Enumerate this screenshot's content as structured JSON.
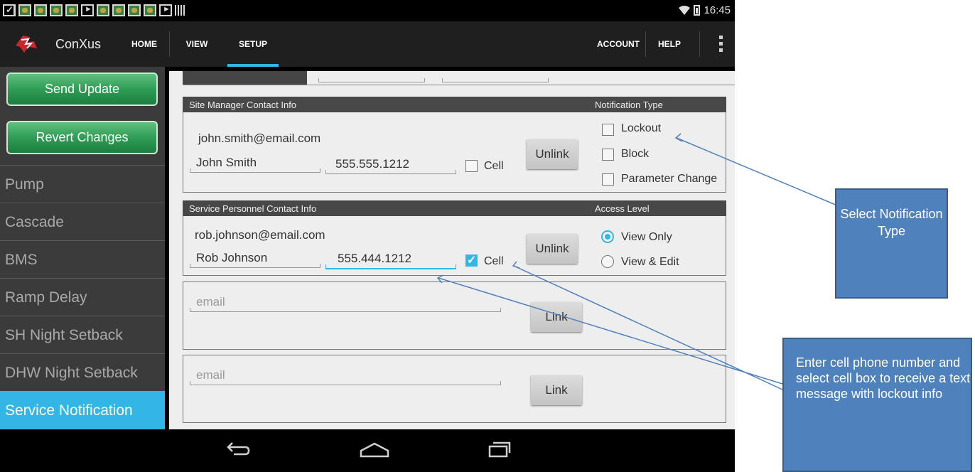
{
  "status_bar": {
    "time": "16:45"
  },
  "header": {
    "app_name": "ConXus",
    "tabs": [
      {
        "label": "HOME"
      },
      {
        "label": "VIEW"
      },
      {
        "label": "SETUP",
        "active": true
      }
    ],
    "right_items": [
      {
        "label": "ACCOUNT"
      },
      {
        "label": "HELP"
      }
    ],
    "accent_color": "#33b5e5"
  },
  "sidebar": {
    "buttons": [
      {
        "label": "Send Update"
      },
      {
        "label": "Revert Changes"
      }
    ],
    "items": [
      {
        "label": "Pump"
      },
      {
        "label": "Cascade"
      },
      {
        "label": "BMS"
      },
      {
        "label": "Ramp Delay"
      },
      {
        "label": "SH Night Setback"
      },
      {
        "label": "DHW Night Setback"
      },
      {
        "label": "Service Notification",
        "active": true
      }
    ]
  },
  "site_manager": {
    "header": "Site Manager Contact Info",
    "right_header": "Notification Type",
    "email": "john.smith@email.com",
    "name": "John Smith",
    "phone": "555.555.1212",
    "cell_label": "Cell",
    "cell_checked": false,
    "button_label": "Unlink",
    "notification_types": [
      {
        "label": "Lockout",
        "checked": false
      },
      {
        "label": "Block",
        "checked": false
      },
      {
        "label": "Parameter Change",
        "checked": false
      }
    ]
  },
  "service_personnel": {
    "header": "Service Personnel Contact Info",
    "right_header": "Access Level",
    "email": "rob.johnson@email.com",
    "name": "Rob Johnson",
    "phone": "555.444.1212",
    "cell_label": "Cell",
    "cell_checked": true,
    "button_label": "Unlink",
    "access_levels": [
      {
        "label": "View Only",
        "selected": true
      },
      {
        "label": "View & Edit",
        "selected": false
      }
    ]
  },
  "empty_contacts": [
    {
      "email_placeholder": "email",
      "button_label": "Link"
    },
    {
      "email_placeholder": "email",
      "button_label": "Link"
    }
  ],
  "annotations": {
    "notification_callout": "Select Notification Type",
    "cell_callout": "Enter cell phone number and select cell box to receive a text message with lockout info",
    "callout_color": "#4f81bd"
  }
}
